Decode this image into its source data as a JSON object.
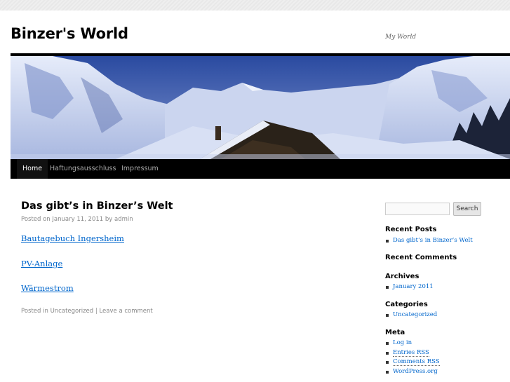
{
  "site": {
    "title": "Binzer's World",
    "description": "My World"
  },
  "nav": {
    "items": [
      {
        "label": "Home",
        "current": true
      },
      {
        "label": "Haftungsausschluss",
        "current": false
      },
      {
        "label": "Impressum",
        "current": false
      }
    ]
  },
  "post": {
    "title": "Das gibt’s in Binzer’s Welt",
    "meta": {
      "posted_on": "Posted on",
      "date": "January 11, 2011",
      "by": "by",
      "author": "admin"
    },
    "links": [
      "Bautagebuch Ingersheim",
      "PV-Anlage",
      "Wärmestrom"
    ],
    "utility": {
      "posted_in": "Posted in",
      "category": "Uncategorized",
      "separator": "|",
      "comment": "Leave a comment"
    }
  },
  "sidebar": {
    "search": {
      "placeholder": "",
      "button": "Search"
    },
    "recent_posts": {
      "title": "Recent Posts",
      "items": [
        "Das gibt’s in Binzer’s Welt"
      ]
    },
    "recent_comments": {
      "title": "Recent Comments"
    },
    "archives": {
      "title": "Archives",
      "items": [
        "January 2011"
      ]
    },
    "categories": {
      "title": "Categories",
      "items": [
        "Uncategorized"
      ]
    },
    "meta": {
      "title": "Meta",
      "items": [
        "Log in",
        "Entries RSS",
        "Comments RSS",
        "WordPress.org"
      ]
    }
  }
}
